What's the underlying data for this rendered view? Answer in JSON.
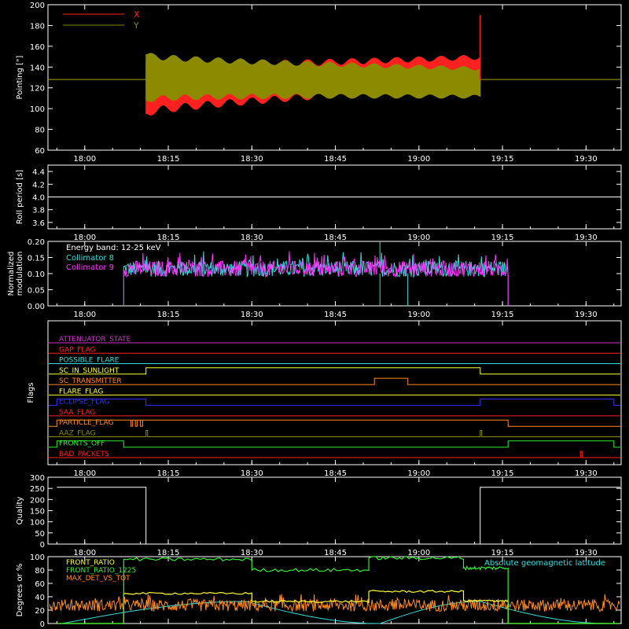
{
  "colors": {
    "background": "#000000",
    "axis": "#ffffff",
    "red": "#ff2020",
    "olive": "#8c8a00",
    "cyan": "#33dddd",
    "magenta": "#ff30ff",
    "purple": "#cc33cc",
    "orange": "#ff8a20",
    "yellow": "#ffff33",
    "blue": "#3333ff",
    "green": "#33ee33",
    "white": "#ffffff"
  },
  "time_ticks": [
    "18:00",
    "18:15",
    "18:30",
    "18:45",
    "19:00",
    "19:15",
    "19:30"
  ],
  "chart_data": [
    {
      "id": "pointing",
      "type": "line",
      "ylabel": "Pointing [\"]",
      "ylim": [
        60,
        200
      ],
      "yticks": [
        60,
        80,
        100,
        120,
        140,
        160,
        180,
        200
      ],
      "series": [
        {
          "name": "X",
          "color_key": "red",
          "start": "18:11",
          "end": "19:11",
          "center_start": 120,
          "center_end": 136,
          "amp_start": 45,
          "amp_end": 24,
          "baseline": 128
        },
        {
          "name": "Y",
          "color_key": "olive",
          "start": "18:11",
          "end": "19:11",
          "center_start": 130,
          "center_end": 125,
          "amp_start": 40,
          "amp_end": 24,
          "baseline": 128
        }
      ]
    },
    {
      "id": "roll-period",
      "type": "line",
      "ylabel": "Roll period [s]",
      "ylim": [
        3.5,
        4.5
      ],
      "yticks": [
        3.6,
        3.8,
        4.0,
        4.2,
        4.4
      ],
      "series": [
        {
          "name": "",
          "color_key": "white",
          "value": 4.0
        }
      ]
    },
    {
      "id": "modulation",
      "type": "line",
      "ylabel": "Normalized modulation",
      "ylim": [
        0,
        0.2
      ],
      "yticks": [
        0.0,
        0.05,
        0.1,
        0.15,
        0.2
      ],
      "annotation": "Energy band: 12-25 keV",
      "series": [
        {
          "name": "Collimator 8",
          "color_key": "cyan",
          "start": "18:07",
          "end": "19:16",
          "mean": 0.115,
          "dips": [
            "18:53",
            "18:58"
          ],
          "spike": "18:53"
        },
        {
          "name": "Collimator 9",
          "color_key": "magenta",
          "start": "18:07",
          "end": "19:16",
          "mean": 0.115
        }
      ]
    },
    {
      "id": "flags",
      "type": "line",
      "ylabel": "Flags",
      "series": [
        {
          "name": "ATTENUATOR_STATE",
          "color_key": "purple",
          "segments": []
        },
        {
          "name": "GAP_FLAG",
          "color_key": "red",
          "segments": []
        },
        {
          "name": "POSSIBLE_FLARE",
          "color_key": "cyan",
          "segments": []
        },
        {
          "name": "SC_IN_SUNLIGHT",
          "color_key": "yellow",
          "segments": [
            [
              "18:11",
              "19:11"
            ]
          ]
        },
        {
          "name": "SC_TRANSMITTER",
          "color_key": "orange",
          "segments": [
            [
              "18:52",
              "18:58"
            ]
          ]
        },
        {
          "name": "FLARE_FLAG",
          "color_key": "yellow",
          "segments": []
        },
        {
          "name": "ECLIPSE_FLAG",
          "color_key": "blue",
          "segments": [
            [
              "17:55",
              "18:11"
            ],
            [
              "19:11",
              "19:35"
            ]
          ]
        },
        {
          "name": "SAA_FLAG",
          "color_key": "red",
          "segments": []
        },
        {
          "name": "PARTICLE_FLAG",
          "color_key": "orange",
          "segments": [
            [
              "17:55",
              "19:16"
            ]
          ]
        },
        {
          "name": "AAZ_FLAG",
          "color_key": "olive",
          "segments": [
            [
              "18:11",
              "18:11"
            ],
            [
              "19:11",
              "19:11"
            ]
          ]
        },
        {
          "name": "FRONTS_OFF",
          "color_key": "green",
          "segments": [
            [
              "17:55",
              "18:07"
            ],
            [
              "19:16",
              "19:35"
            ]
          ]
        },
        {
          "name": "BAD_PACKETS",
          "color_key": "red",
          "segments": [
            [
              "19:29",
              "19:29"
            ]
          ]
        }
      ]
    },
    {
      "id": "quality",
      "type": "line",
      "ylabel": "Quality",
      "ylim": [
        0,
        300
      ],
      "yticks": [
        0,
        50,
        100,
        150,
        200,
        250,
        300
      ],
      "series": [
        {
          "name": "",
          "color_key": "white",
          "steps": [
            [
              "17:55",
              255
            ],
            [
              "18:11",
              0
            ],
            [
              "19:11",
              255
            ]
          ]
        }
      ]
    },
    {
      "id": "detectors",
      "type": "line",
      "ylabel": "Degrees or %",
      "ylim": [
        0,
        100
      ],
      "yticks": [
        0,
        20,
        40,
        60,
        80,
        100
      ],
      "annotation": "Absolute geomagnetic latitude",
      "series": [
        {
          "name": "FRONT_RATIO",
          "color_key": "yellow",
          "steps": [
            [
              "17:55",
              0
            ],
            [
              "18:07",
              45
            ],
            [
              "18:30",
              33
            ],
            [
              "18:51",
              48
            ],
            [
              "19:08",
              34
            ],
            [
              "19:16",
              0
            ]
          ]
        },
        {
          "name": "FRONT_RATIO_1225",
          "color_key": "green",
          "steps": [
            [
              "17:55",
              0
            ],
            [
              "18:07",
              96
            ],
            [
              "18:30",
              80
            ],
            [
              "18:51",
              98
            ],
            [
              "19:08",
              83
            ],
            [
              "19:16",
              0
            ]
          ]
        },
        {
          "name": "MAX_DET_VS_TOT",
          "color_key": "orange",
          "mean": 27,
          "noise": 9
        },
        {
          "name": "geomagnetic-latitude",
          "color_key": "cyan",
          "peaks": [
            "18:29",
            "19:11"
          ],
          "zeros": [
            "17:56",
            "18:53",
            "19:34"
          ],
          "peak_value": 33
        }
      ]
    }
  ]
}
